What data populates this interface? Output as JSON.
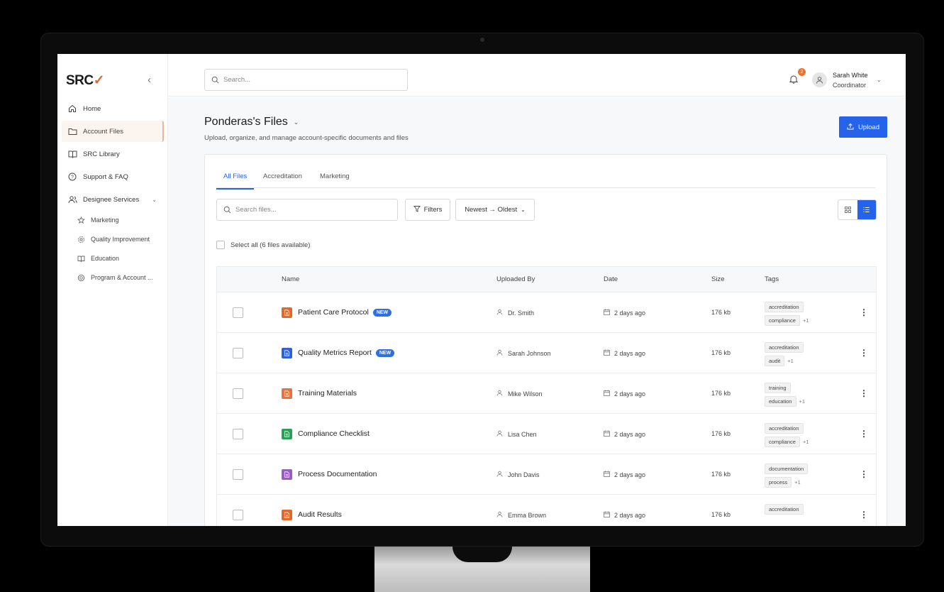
{
  "brand": {
    "logo_text": "SRC",
    "logo_mark": "✓",
    "accent": "#e06a2c",
    "primary": "#2563eb"
  },
  "sidebar": {
    "items": [
      {
        "label": "Home",
        "icon": "home-icon"
      },
      {
        "label": "Account Files",
        "icon": "folder-icon",
        "active": true
      },
      {
        "label": "SRC Library",
        "icon": "book-icon"
      },
      {
        "label": "Support & FAQ",
        "icon": "help-circle-icon"
      },
      {
        "label": "Designee Services",
        "icon": "users-icon"
      }
    ],
    "subitems": [
      {
        "label": "Marketing",
        "icon": "star-icon"
      },
      {
        "label": "Quality Improvement",
        "icon": "gear-icon"
      },
      {
        "label": "Education",
        "icon": "book-open-icon"
      },
      {
        "label": "Program & Account ...",
        "icon": "lifebuoy-icon"
      }
    ]
  },
  "topbar": {
    "search_placeholder": "Search...",
    "notification_count": "2",
    "user_name": "Sarah White",
    "user_role": "Coordinator"
  },
  "page": {
    "title": "Ponderas's Files",
    "subtitle": "Upload, organize, and manage account-specific documents and files",
    "upload_label": "Upload"
  },
  "tabs": [
    {
      "label": "All Files",
      "active": true
    },
    {
      "label": "Accreditation"
    },
    {
      "label": "Marketing"
    }
  ],
  "toolbar": {
    "search_placeholder": "Search files...",
    "filters_label": "Filters",
    "sort_label": "Newest → Oldest",
    "view_mode": "list"
  },
  "select_all_label": "Select all (6 files available)",
  "table": {
    "headers": {
      "name": "Name",
      "uploaded_by": "Uploaded By",
      "date": "Date",
      "size": "Size",
      "tags": "Tags"
    },
    "rows": [
      {
        "name": "Patient Care Protocol",
        "badge": "NEW",
        "icon_color": "#e06a2c",
        "uploaded_by": "Dr. Smith",
        "date": "2 days ago",
        "size": "176 kb",
        "tags": [
          "accreditation",
          "compliance"
        ],
        "more": "+1"
      },
      {
        "name": "Quality Metrics Report",
        "badge": "NEW",
        "icon_color": "#2f62d6",
        "uploaded_by": "Sarah Johnson",
        "date": "2 days ago",
        "size": "176 kb",
        "tags": [
          "accreditation",
          "audit"
        ],
        "more": "+1"
      },
      {
        "name": "Training Materials",
        "badge": "",
        "icon_color": "#e8733a",
        "uploaded_by": "Mike Wilson",
        "date": "2 days ago",
        "size": "176 kb",
        "tags": [
          "training",
          "education"
        ],
        "more": "+1"
      },
      {
        "name": "Compliance Checklist",
        "badge": "",
        "icon_color": "#2e9e57",
        "uploaded_by": "Lisa Chen",
        "date": "2 days ago",
        "size": "176 kb",
        "tags": [
          "accreditation",
          "compliance"
        ],
        "more": "+1"
      },
      {
        "name": "Process Documentation",
        "badge": "",
        "icon_color": "#9b59d0",
        "uploaded_by": "John Davis",
        "date": "2 days ago",
        "size": "176 kb",
        "tags": [
          "documentation",
          "process"
        ],
        "more": "+1"
      },
      {
        "name": "Audit Results",
        "badge": "",
        "icon_color": "#e06a2c",
        "uploaded_by": "Emma Brown",
        "date": "2 days ago",
        "size": "176 kb",
        "tags": [
          "accreditation"
        ],
        "more": ""
      }
    ]
  }
}
